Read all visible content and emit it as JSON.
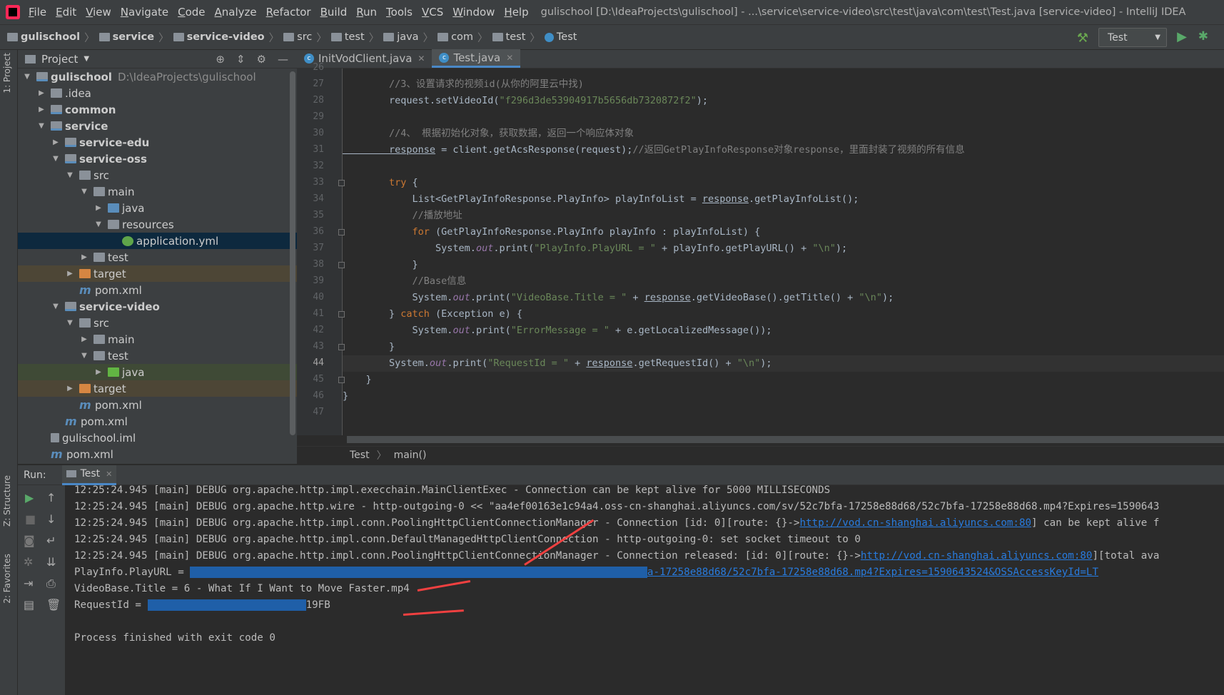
{
  "menubar": {
    "items": [
      {
        "label": "File",
        "u": "F",
        "rest": "ile"
      },
      {
        "label": "Edit",
        "u": "E",
        "rest": "dit"
      },
      {
        "label": "View",
        "u": "V",
        "rest": "iew"
      },
      {
        "label": "Navigate",
        "u": "N",
        "rest": "avigate"
      },
      {
        "label": "Code",
        "u": "C",
        "rest": "ode"
      },
      {
        "label": "Analyze",
        "u": "A",
        "rest": "nalyze"
      },
      {
        "label": "Refactor",
        "u": "R",
        "rest": "efactor"
      },
      {
        "label": "Build",
        "u": "B",
        "rest": "uild"
      },
      {
        "label": "Run",
        "u": "R",
        "rest": "un"
      },
      {
        "label": "Tools",
        "u": "T",
        "rest": "ools"
      },
      {
        "label": "VCS",
        "u": "V",
        "rest": "CS"
      },
      {
        "label": "Window",
        "u": "W",
        "rest": "indow"
      },
      {
        "label": "Help",
        "u": "H",
        "rest": "elp"
      }
    ],
    "window_title": "gulischool [D:\\IdeaProjects\\gulischool] - ...\\service\\service-video\\src\\test\\java\\com\\test\\Test.java [service-video] - IntelliJ IDEA"
  },
  "breadcrumbs": [
    "gulischool",
    "service",
    "service-video",
    "src",
    "test",
    "java",
    "com",
    "test",
    "Test"
  ],
  "run_config": {
    "label": "Test"
  },
  "left_strip": {
    "project_tab": "1: Project",
    "structure_tab": "Z: Structure",
    "favorites_tab": "2: Favorites"
  },
  "project_panel": {
    "title": "Project",
    "tree": [
      {
        "label": "gulischool",
        "path": "D:\\IdeaProjects\\gulischool",
        "level": 0,
        "arrow": "▼",
        "icon": "mod",
        "bold": true
      },
      {
        "label": ".idea",
        "level": 1,
        "arrow": "▶",
        "icon": "folder"
      },
      {
        "label": "common",
        "level": 1,
        "arrow": "▶",
        "icon": "mod",
        "bold": true
      },
      {
        "label": "service",
        "level": 1,
        "arrow": "▼",
        "icon": "mod",
        "bold": true
      },
      {
        "label": "service-edu",
        "level": 2,
        "arrow": "▶",
        "icon": "mod",
        "bold": true
      },
      {
        "label": "service-oss",
        "level": 2,
        "arrow": "▼",
        "icon": "mod",
        "bold": true
      },
      {
        "label": "src",
        "level": 3,
        "arrow": "▼",
        "icon": "folder"
      },
      {
        "label": "main",
        "level": 4,
        "arrow": "▼",
        "icon": "folder"
      },
      {
        "label": "java",
        "level": 5,
        "arrow": "▶",
        "icon": "src"
      },
      {
        "label": "resources",
        "level": 5,
        "arrow": "▼",
        "icon": "folder"
      },
      {
        "label": "application.yml",
        "level": 6,
        "arrow": "",
        "icon": "yml",
        "state": "sel"
      },
      {
        "label": "test",
        "level": 4,
        "arrow": "▶",
        "icon": "folder"
      },
      {
        "label": "target",
        "level": 3,
        "arrow": "▶",
        "icon": "tgt",
        "state": "tg"
      },
      {
        "label": "pom.xml",
        "level": 3,
        "arrow": "",
        "icon": "m"
      },
      {
        "label": "service-video",
        "level": 2,
        "arrow": "▼",
        "icon": "mod",
        "bold": true
      },
      {
        "label": "src",
        "level": 3,
        "arrow": "▼",
        "icon": "folder"
      },
      {
        "label": "main",
        "level": 4,
        "arrow": "▶",
        "icon": "folder"
      },
      {
        "label": "test",
        "level": 4,
        "arrow": "▼",
        "icon": "folder"
      },
      {
        "label": "java",
        "level": 5,
        "arrow": "▶",
        "icon": "tst",
        "state": "tj"
      },
      {
        "label": "target",
        "level": 3,
        "arrow": "▶",
        "icon": "tgt",
        "state": "tg"
      },
      {
        "label": "pom.xml",
        "level": 3,
        "arrow": "",
        "icon": "m"
      },
      {
        "label": "pom.xml",
        "level": 2,
        "arrow": "",
        "icon": "m"
      },
      {
        "label": "gulischool.iml",
        "level": 1,
        "arrow": "",
        "icon": "iml"
      },
      {
        "label": "pom.xml",
        "level": 1,
        "arrow": "",
        "icon": "m"
      }
    ]
  },
  "editor": {
    "tabs": [
      {
        "label": "InitVodClient.java",
        "active": false
      },
      {
        "label": "Test.java",
        "active": true
      }
    ],
    "lines": [
      {
        "n": "26",
        "segs": []
      },
      {
        "n": "27",
        "segs": [
          [
            "cm",
            "        //3、设置请求的视频id(从你的阿里云中找)"
          ]
        ]
      },
      {
        "n": "28",
        "segs": [
          [
            "",
            "        request.setVideoId("
          ],
          [
            "str",
            "\"f296d3de53904917b5656db7320872f2\""
          ],
          [
            "",
            ");"
          ]
        ]
      },
      {
        "n": "29",
        "segs": []
      },
      {
        "n": "30",
        "segs": [
          [
            "cm",
            "        //4、 根据初始化对象，获取数据，返回一个响应体对象"
          ]
        ]
      },
      {
        "n": "31",
        "segs": [
          [
            "ul",
            "        response"
          ],
          [
            "",
            " = client.getAcsResponse(request);"
          ],
          [
            "cm",
            "//返回GetPlayInfoResponse对象response，里面封装了视频的所有信息"
          ]
        ]
      },
      {
        "n": "32",
        "segs": []
      },
      {
        "n": "33",
        "segs": [
          [
            "kw",
            "        try"
          ],
          [
            "",
            " {"
          ]
        ]
      },
      {
        "n": "34",
        "segs": [
          [
            "",
            "            List<GetPlayInfoResponse.PlayInfo> playInfoList = "
          ],
          [
            "ul",
            "response"
          ],
          [
            "",
            ".getPlayInfoList();"
          ]
        ]
      },
      {
        "n": "35",
        "segs": [
          [
            "cm",
            "            //播放地址"
          ]
        ]
      },
      {
        "n": "36",
        "segs": [
          [
            "kw",
            "            for"
          ],
          [
            "",
            " (GetPlayInfoResponse.PlayInfo playInfo : playInfoList) {"
          ]
        ]
      },
      {
        "n": "37",
        "segs": [
          [
            "",
            "                System."
          ],
          [
            "fld",
            "out"
          ],
          [
            "",
            ".print("
          ],
          [
            "str",
            "\"PlayInfo.PlayURL = \""
          ],
          [
            "",
            " + playInfo.getPlayURL() + "
          ],
          [
            "str",
            "\"\\n\""
          ],
          [
            "",
            ");"
          ]
        ]
      },
      {
        "n": "38",
        "segs": [
          [
            "",
            "            }"
          ]
        ]
      },
      {
        "n": "39",
        "segs": [
          [
            "cm",
            "            //Base信息"
          ]
        ]
      },
      {
        "n": "40",
        "segs": [
          [
            "",
            "            System."
          ],
          [
            "fld",
            "out"
          ],
          [
            "",
            ".print("
          ],
          [
            "str",
            "\"VideoBase.Title = \""
          ],
          [
            "",
            " + "
          ],
          [
            "ul",
            "response"
          ],
          [
            "",
            ".getVideoBase().getTitle() + "
          ],
          [
            "str",
            "\"\\n\""
          ],
          [
            "",
            ");"
          ]
        ]
      },
      {
        "n": "41",
        "segs": [
          [
            "",
            "        } "
          ],
          [
            "kw",
            "catch"
          ],
          [
            "",
            " (Exception e) {"
          ]
        ]
      },
      {
        "n": "42",
        "segs": [
          [
            "",
            "            System."
          ],
          [
            "fld",
            "out"
          ],
          [
            "",
            ".print("
          ],
          [
            "str",
            "\"ErrorMessage = \""
          ],
          [
            "",
            " + e.getLocalizedMessage());"
          ]
        ]
      },
      {
        "n": "43",
        "segs": [
          [
            "",
            "        }"
          ]
        ]
      },
      {
        "n": "44",
        "segs": [
          [
            "",
            "        System."
          ],
          [
            "fld",
            "out"
          ],
          [
            "",
            ".print("
          ],
          [
            "str",
            "\"RequestId = \""
          ],
          [
            "",
            " + "
          ],
          [
            "ul",
            "response"
          ],
          [
            "",
            ".getRequestId() + "
          ],
          [
            "str",
            "\"\\n\""
          ],
          [
            "",
            ");"
          ]
        ],
        "current": true
      },
      {
        "n": "45",
        "segs": [
          [
            "",
            "    }"
          ]
        ]
      },
      {
        "n": "46",
        "segs": [
          [
            "",
            "}"
          ]
        ]
      },
      {
        "n": "47",
        "segs": []
      }
    ],
    "breadcrumb": [
      "Test",
      "main()"
    ]
  },
  "run_panel": {
    "label": "Run:",
    "tab": "Test",
    "console": [
      {
        "segs": [
          [
            "",
            "12:25:24.945 [main] DEBUG org.apache.http.impl.execchain.MainClientExec - Connection can be kept alive for 5000 MILLISECONDS"
          ]
        ]
      },
      {
        "segs": [
          [
            "",
            "12:25:24.945 [main] DEBUG org.apache.http.wire - http-outgoing-0 << \"aa4ef00163e1c94a4.oss-cn-shanghai.aliyuncs.com/sv/52c7bfa-17258e88d68/52c7bfa-17258e88d68.mp4?Expires=1590643"
          ]
        ]
      },
      {
        "segs": [
          [
            "",
            "12:25:24.945 [main] DEBUG org.apache.http.impl.conn.PoolingHttpClientConnectionManager - Connection [id: 0][route: {}->"
          ],
          [
            "link",
            "http://vod.cn-shanghai.aliyuncs.com:80"
          ],
          [
            "",
            "] can be kept alive f"
          ]
        ]
      },
      {
        "segs": [
          [
            "",
            "12:25:24.945 [main] DEBUG org.apache.http.impl.conn.DefaultManagedHttpClientConnection - http-outgoing-0: set socket timeout to 0"
          ]
        ]
      },
      {
        "segs": [
          [
            "",
            "12:25:24.945 [main] DEBUG org.apache.http.impl.conn.PoolingHttpClientConnectionManager - Connection released: [id: 0][route: {}->"
          ],
          [
            "link",
            "http://vod.cn-shanghai.aliyuncs.com:80"
          ],
          [
            "",
            "][total ava"
          ]
        ]
      },
      {
        "segs": [
          [
            "",
            "PlayInfo.PlayURL = "
          ],
          [
            "blur",
            "h                                                                          "
          ],
          [
            "link",
            "a-17258e88d68/52c7bfa-17258e88d68.mp4?Expires=1590643524&OSSAccessKeyId=LT"
          ]
        ]
      },
      {
        "segs": [
          [
            "",
            "VideoBase.Title = 6 - What If I Want to Move Faster.mp4"
          ]
        ]
      },
      {
        "segs": [
          [
            "",
            "RequestId = "
          ],
          [
            "blur",
            "D                         "
          ],
          [
            "",
            "19FB"
          ]
        ]
      },
      {
        "segs": []
      },
      {
        "segs": [
          [
            "",
            "Process finished with exit code 0"
          ]
        ]
      }
    ]
  }
}
